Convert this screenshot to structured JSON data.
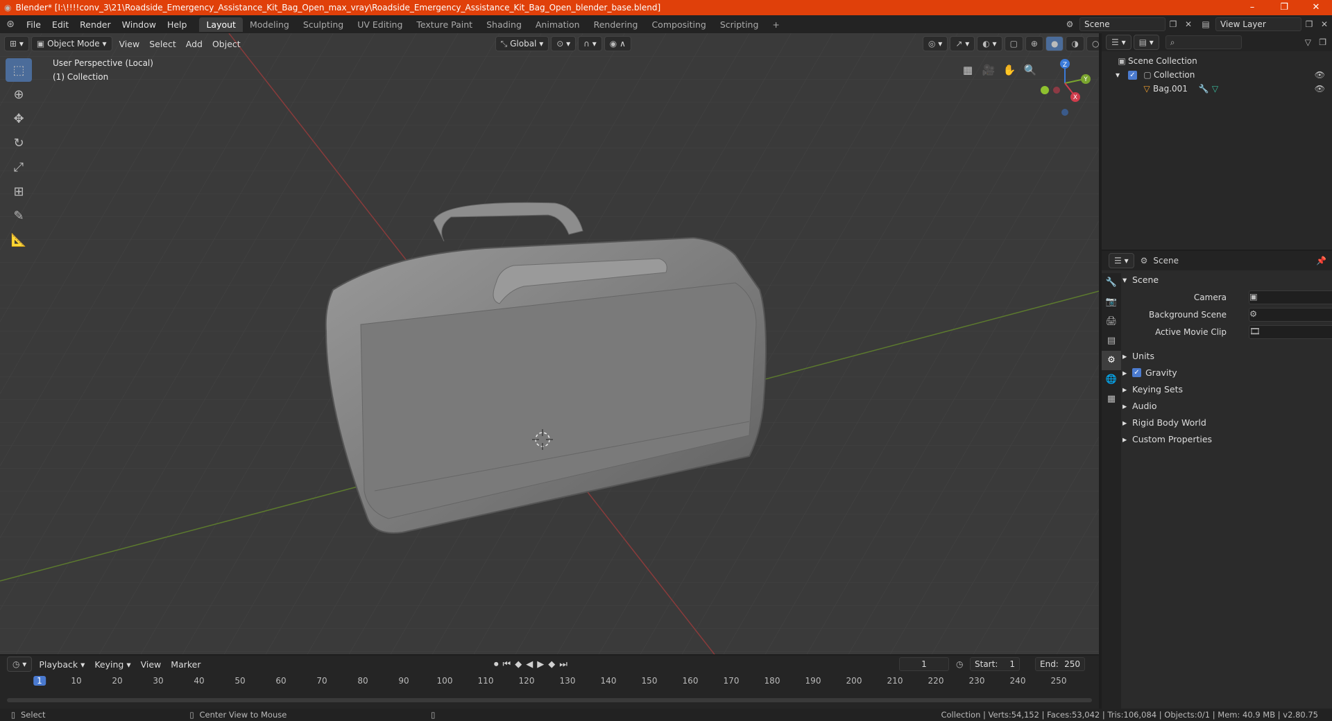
{
  "window": {
    "title": "Blender* [I:\\!!!!conv_3\\21\\Roadside_Emergency_Assistance_Kit_Bag_Open_max_vray\\Roadside_Emergency_Assistance_Kit_Bag_Open_blender_base.blend]",
    "min": "–",
    "max": "❐",
    "close": "✕"
  },
  "menu": [
    "File",
    "Edit",
    "Render",
    "Window",
    "Help"
  ],
  "workspaces": [
    "Layout",
    "Modeling",
    "Sculpting",
    "UV Editing",
    "Texture Paint",
    "Shading",
    "Animation",
    "Rendering",
    "Compositing",
    "Scripting"
  ],
  "active_workspace": "Layout",
  "scene_name": "Scene",
  "view_layer": "View Layer",
  "viewport": {
    "mode": "Object Mode",
    "menus": [
      "View",
      "Select",
      "Add",
      "Object"
    ],
    "transform_orientation": "Global",
    "overlay_line1": "User Perspective (Local)",
    "overlay_line2": "(1) Collection",
    "gizmo_axes": [
      "X",
      "Y",
      "Z"
    ]
  },
  "outliner": {
    "root": "Scene Collection",
    "collection": "Collection",
    "object": "Bag.001"
  },
  "properties": {
    "context": "Scene",
    "panel": "Scene",
    "fields": [
      {
        "label": "Camera"
      },
      {
        "label": "Background Scene"
      },
      {
        "label": "Active Movie Clip"
      }
    ],
    "sections": [
      "Units",
      "Gravity",
      "Keying Sets",
      "Audio",
      "Rigid Body World",
      "Custom Properties"
    ],
    "gravity_checked": true
  },
  "timeline": {
    "menus": [
      "Playback",
      "Keying",
      "View",
      "Marker"
    ],
    "current_frame": "1",
    "start_label": "Start:",
    "start": "1",
    "end_label": "End:",
    "end": "250",
    "ticks": [
      "10",
      "20",
      "30",
      "40",
      "50",
      "60",
      "70",
      "80",
      "90",
      "100",
      "110",
      "120",
      "130",
      "140",
      "150",
      "160",
      "170",
      "180",
      "190",
      "200",
      "210",
      "220",
      "230",
      "240",
      "250"
    ]
  },
  "status": {
    "left_action": "Select",
    "mid_action": "Center View to Mouse",
    "stats": "Collection | Verts:54,152 | Faces:53,042 | Tris:106,084 | Objects:0/1 | Mem: 40.9 MB | v2.80.75"
  },
  "colors": {
    "title_bar": "#e0400a",
    "active_tool": "#4b6c9a",
    "frame_marker": "#4a7ad0"
  }
}
